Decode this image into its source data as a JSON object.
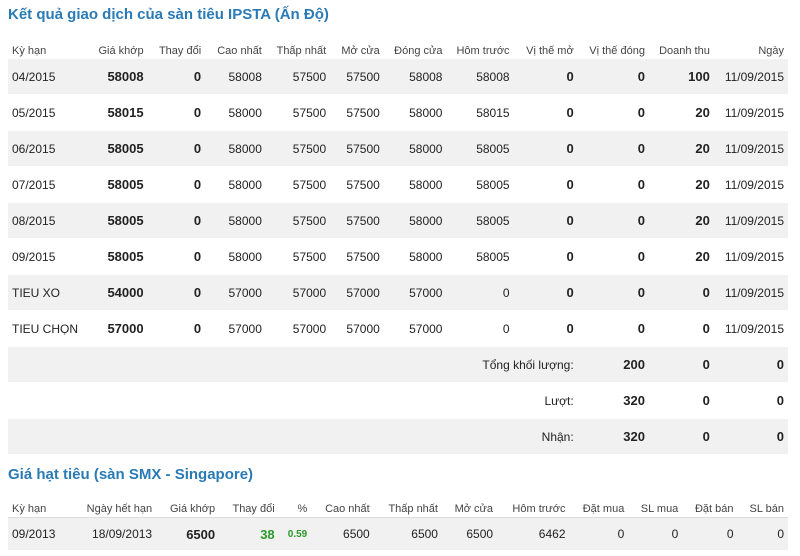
{
  "section1": {
    "title": "Kết quả giao dịch của sàn tiêu IPSTA (Ấn Độ)",
    "headers": [
      "Kỳ hạn",
      "Giá khớp",
      "Thay đổi",
      "Cao nhất",
      "Thấp nhất",
      "Mở cửa",
      "Đóng cửa",
      "Hôm trước",
      "Vị thế mở",
      "Vị thế đóng",
      "Doanh thu",
      "Ngày"
    ],
    "rows": [
      [
        "04/2015",
        "58008",
        "0",
        "58008",
        "57500",
        "57500",
        "58008",
        "58008",
        "0",
        "0",
        "100",
        "11/09/2015"
      ],
      [
        "05/2015",
        "58015",
        "0",
        "58000",
        "57500",
        "57500",
        "58000",
        "58015",
        "0",
        "0",
        "20",
        "11/09/2015"
      ],
      [
        "06/2015",
        "58005",
        "0",
        "58000",
        "57500",
        "57500",
        "58000",
        "58005",
        "0",
        "0",
        "20",
        "11/09/2015"
      ],
      [
        "07/2015",
        "58005",
        "0",
        "58000",
        "57500",
        "57500",
        "58000",
        "58005",
        "0",
        "0",
        "20",
        "11/09/2015"
      ],
      [
        "08/2015",
        "58005",
        "0",
        "58000",
        "57500",
        "57500",
        "58000",
        "58005",
        "0",
        "0",
        "20",
        "11/09/2015"
      ],
      [
        "09/2015",
        "58005",
        "0",
        "58000",
        "57500",
        "57500",
        "58000",
        "58005",
        "0",
        "0",
        "20",
        "11/09/2015"
      ],
      [
        "TIEU XO",
        "54000",
        "0",
        "57000",
        "57000",
        "57000",
        "57000",
        "0",
        "0",
        "0",
        "0",
        "11/09/2015"
      ],
      [
        "TIEU CHỌN",
        "57000",
        "0",
        "57000",
        "57000",
        "57000",
        "57000",
        "0",
        "0",
        "0",
        "0",
        "11/09/2015"
      ]
    ],
    "totals": [
      {
        "label": "Tổng khối lượng:",
        "v1": "200",
        "v2": "0",
        "v3": "0"
      },
      {
        "label": "Lượt:",
        "v1": "320",
        "v2": "0",
        "v3": "0"
      },
      {
        "label": "Nhận:",
        "v1": "320",
        "v2": "0",
        "v3": "0"
      }
    ]
  },
  "section2": {
    "title": "Giá hạt tiêu (sàn SMX - Singapore)",
    "headers": [
      "Kỳ hạn",
      "Ngày hết hạn",
      "Giá khớp",
      "Thay đổi",
      "%",
      "Cao nhất",
      "Thấp nhất",
      "Mở cửa",
      "Hôm trước",
      "Đặt mua",
      "SL mua",
      "Đặt bán",
      "SL bán"
    ],
    "rows": [
      [
        "09/2013",
        "18/09/2013",
        "6500",
        "38",
        "0.59",
        "6500",
        "6500",
        "6500",
        "6462",
        "0",
        "0",
        "0",
        "0"
      ]
    ]
  }
}
